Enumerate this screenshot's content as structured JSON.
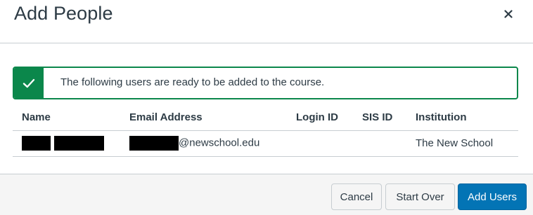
{
  "modal": {
    "title": "Add People",
    "close_icon": "close-icon"
  },
  "alert": {
    "icon": "checkmark-icon",
    "message": "The following users are ready to be added to the course.",
    "color": "#0b874b"
  },
  "table": {
    "headers": {
      "name": "Name",
      "email": "Email Address",
      "login_id": "Login ID",
      "sis_id": "SIS ID",
      "institution": "Institution"
    },
    "rows": [
      {
        "name": "[redacted]",
        "email_domain": "@newschool.edu",
        "login_id": "",
        "sis_id": "",
        "institution": "The New School"
      }
    ]
  },
  "footer": {
    "cancel_label": "Cancel",
    "start_over_label": "Start Over",
    "add_users_label": "Add Users",
    "primary_color": "#0374b5"
  }
}
